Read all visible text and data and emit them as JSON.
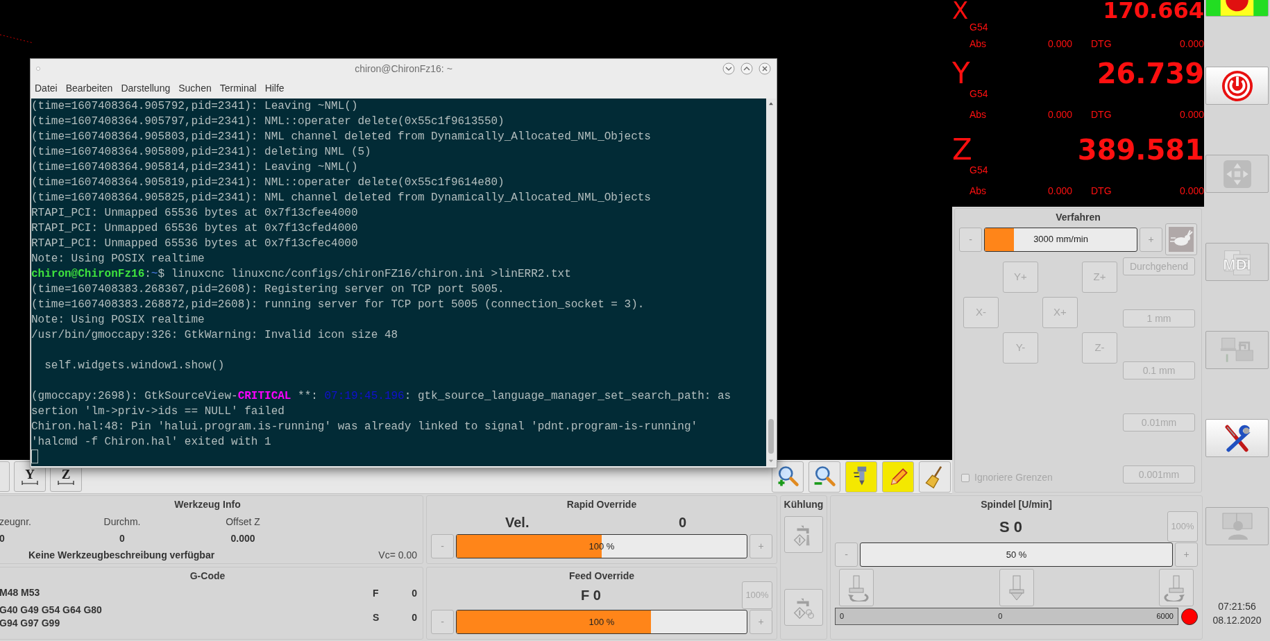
{
  "terminal": {
    "title": "chiron@ChironFz16: ~",
    "menu": [
      "Datei",
      "Bearbeiten",
      "Darstellung",
      "Suchen",
      "Terminal",
      "Hilfe"
    ],
    "lines": [
      {
        "text": "(time=1607408364.905792,pid=2341): Leaving ~NML()"
      },
      {
        "text": "(time=1607408364.905797,pid=2341): NML::operater delete(0x55c1f9613550)"
      },
      {
        "text": "(time=1607408364.905803,pid=2341): NML channel deleted from Dynamically_Allocated_NML_Objects"
      },
      {
        "text": "(time=1607408364.905809,pid=2341): deleting NML (5)"
      },
      {
        "text": "(time=1607408364.905814,pid=2341): Leaving ~NML()"
      },
      {
        "text": "(time=1607408364.905819,pid=2341): NML::operater delete(0x55c1f9614e80)"
      },
      {
        "text": "(time=1607408364.905825,pid=2341): NML channel deleted from Dynamically_Allocated_NML_Objects"
      },
      {
        "text": "RTAPI_PCI: Unmapped 65536 bytes at 0x7f13cfee4000"
      },
      {
        "text": "RTAPI_PCI: Unmapped 65536 bytes at 0x7f13cfed4000"
      },
      {
        "text": "RTAPI_PCI: Unmapped 65536 bytes at 0x7f13cfec4000"
      },
      {
        "text": "Note: Using POSIX realtime"
      },
      {
        "segments": [
          {
            "kind": "user",
            "text": "chiron@ChironFz16"
          },
          {
            "kind": "plain",
            "text": ":"
          },
          {
            "kind": "path",
            "text": "~"
          },
          {
            "kind": "plain",
            "text": "$ linuxcnc linuxcnc/configs/chironFZ16/chiron.ini >linERR2.txt"
          }
        ]
      },
      {
        "text": "(time=1607408383.268367,pid=2608): Registering server on TCP port 5005."
      },
      {
        "text": "(time=1607408383.268872,pid=2608): running server for TCP port 5005 (connection_socket = 3)."
      },
      {
        "text": "Note: Using POSIX realtime"
      },
      {
        "text": "/usr/bin/gmoccapy:326: GtkWarning: Invalid icon size 48"
      },
      {
        "text": "  self.widgets.window1.show()",
        "space_before": true
      },
      {
        "segments": [
          {
            "kind": "plain",
            "text": "(gmoccapy:2698): GtkSourceView-"
          },
          {
            "kind": "critical",
            "text": "CRITICAL"
          },
          {
            "kind": "plain",
            "text": " **: "
          },
          {
            "kind": "timestamp",
            "text": "07:19:45.196"
          },
          {
            "kind": "plain",
            "text": ": gtk_source_language_manager_set_search_path: as"
          }
        ],
        "space_before": true
      },
      {
        "text": "sertion 'lm->priv->ids == NULL' failed"
      },
      {
        "text": "Chiron.hal:48: Pin 'halui.program.is-running' was already linked to signal 'pdnt.program-is-running'"
      },
      {
        "text": "'halcmd -f Chiron.hal' exited with 1"
      }
    ]
  },
  "view_buttons": [
    "Y",
    "Z"
  ],
  "toolbar_buttons": [
    {
      "kind": "zoom_in"
    },
    {
      "kind": "zoom_out"
    },
    {
      "kind": "tool"
    },
    {
      "kind": "edit"
    },
    {
      "kind": "clear"
    }
  ],
  "dro": {
    "axes": [
      {
        "axis": "X",
        "value": "170.664",
        "offset": "G54",
        "abs_label": "Abs",
        "abs": "0.000",
        "dtg_label": "DTG",
        "dtg": "0.000"
      },
      {
        "axis": "Y",
        "value": "26.739",
        "offset": "G54",
        "abs_label": "Abs",
        "abs": "0.000",
        "dtg_label": "DTG",
        "dtg": "0.000"
      },
      {
        "axis": "Z",
        "value": "389.581",
        "offset": "G54",
        "abs_label": "Abs",
        "abs": "0.000",
        "dtg_label": "DTG",
        "dtg": "0.000"
      }
    ]
  },
  "jog": {
    "title": "Verfahren",
    "minus": "-",
    "plus": "+",
    "reading": "3000 mm/min",
    "level": 0.19,
    "buttons": [
      "Y+",
      "Z+",
      "X-",
      "X+",
      "Y-",
      "Z-"
    ],
    "increments": [
      "Durchgehend",
      "1 mm",
      "0.1 mm",
      "0.01mm",
      "0.001mm"
    ],
    "ignore_limits": {
      "label": "Ignoriere Grenzen",
      "checked": false
    }
  },
  "side_buttons": [
    {
      "kind": "estop",
      "disabled": false
    },
    {
      "kind": "power",
      "disabled": false
    },
    {
      "kind": "jog",
      "disabled": true
    },
    {
      "kind": "mdi",
      "label": "MDI",
      "disabled": true
    },
    {
      "kind": "auto",
      "disabled": true
    },
    {
      "kind": "settings",
      "disabled": false
    },
    {
      "kind": "user",
      "disabled": true
    }
  ],
  "clock": {
    "time": "07:21:56",
    "date": "08.12.2020"
  },
  "tool_info": {
    "title": "Werkzeug Info",
    "columns": [
      {
        "label": "zeugnr.",
        "value": "0"
      },
      {
        "label": "Durchm.",
        "value": "0"
      },
      {
        "label": "Offset Z",
        "value": "0.000"
      }
    ],
    "description": "Keine Werkzeugbeschreibung verfügbar",
    "vc": "Vc= 0.00"
  },
  "gcode": {
    "title": "G-Code",
    "lines": [
      "M48 M53",
      "G40 G49 G54 G64 G80",
      "G94 G97 G99"
    ],
    "f_label": "F",
    "f": "0",
    "s_label": "S",
    "s": "0"
  },
  "rapid_override": {
    "title": "Rapid Override",
    "label": "Vel.",
    "value": "0",
    "minus": "-",
    "plus": "+",
    "reading": "100 %",
    "level": 0.5
  },
  "feed_override": {
    "title": "Feed Override",
    "value": "F 0",
    "reset": "100%",
    "minus": "-",
    "plus": "+",
    "reading": "100 %",
    "level": 0.67
  },
  "coolant": {
    "title": "Kühlung",
    "buttons": [
      {
        "kind": "flood"
      },
      {
        "kind": "mist"
      }
    ]
  },
  "spindle": {
    "title": "Spindel [U/min]",
    "value": "S 0",
    "reset": "100%",
    "minus": "-",
    "plus": "+",
    "reading": "50 %",
    "buttons": [
      {
        "kind": "ccw"
      },
      {
        "kind": "stop"
      },
      {
        "kind": "cw"
      }
    ],
    "scale_min": "0",
    "scale_mid": "0",
    "scale_max": "6000",
    "at_speed": false
  }
}
